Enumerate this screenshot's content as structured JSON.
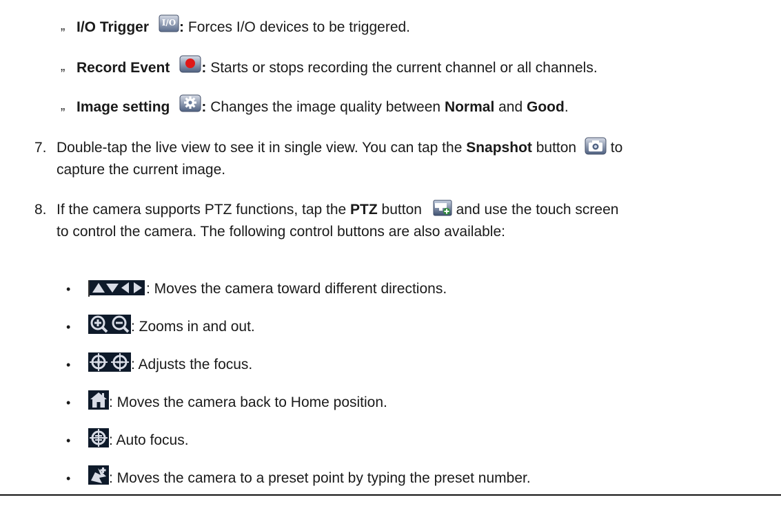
{
  "subitems": [
    {
      "title": "I/O Trigger",
      "icon": "io-icon",
      "desc": " Forces I/O devices to be triggered."
    },
    {
      "title": "Record Event",
      "icon": "record-icon",
      "desc": " Starts or stops recording the current channel or all channels."
    },
    {
      "title": "Image setting",
      "icon": "gear-icon",
      "desc_pre": " Changes the image quality between ",
      "normal": "Normal",
      "and": " and ",
      "good": "Good",
      "end": "."
    }
  ],
  "sub_bullet": "„",
  "colon": ":",
  "step7": {
    "num": "7.",
    "pre": "Double-tap the live view to see it in single view. You can tap the ",
    "snapshot": "Snapshot",
    "mid": " button ",
    "icon": "camera-icon",
    "post": " to",
    "line2": "capture the current image."
  },
  "step8": {
    "num": "8.",
    "pre": "If the camera supports PTZ functions, tap the ",
    "ptz": "PTZ",
    "mid": " button ",
    "icon": "ptz-icon",
    "post": " and use the touch screen",
    "line2": "to control the camera. The following control buttons are also available:"
  },
  "controls": [
    {
      "icon": "direction-arrows-icon",
      "text": ": Moves the camera toward different directions."
    },
    {
      "icon": "zoom-icon",
      "text": ": Zooms in and out."
    },
    {
      "icon": "focus-icon",
      "text": ": Adjusts the focus."
    },
    {
      "icon": "home-icon",
      "text": ": Moves the camera back to Home position."
    },
    {
      "icon": "auto-focus-icon",
      "text": ": Auto focus."
    },
    {
      "icon": "preset-icon",
      "text": ": Moves the camera to a preset point by typing the preset number."
    }
  ],
  "dot_bullet": "•"
}
